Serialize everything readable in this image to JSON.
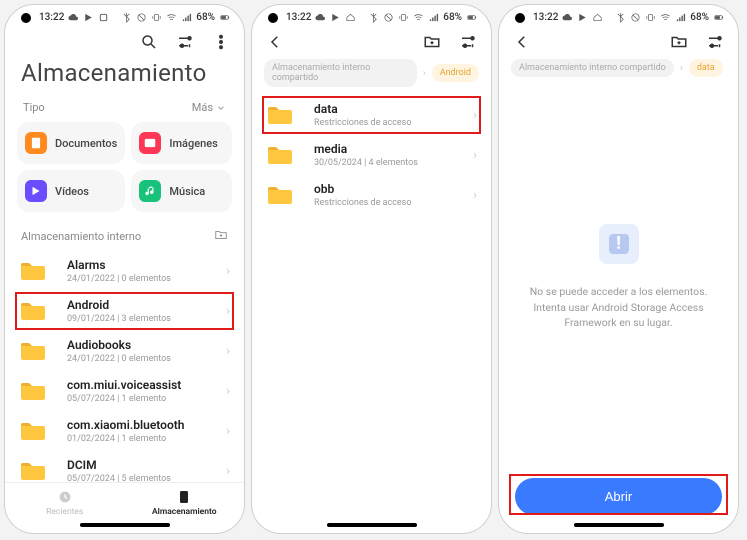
{
  "status": {
    "time": "13:22",
    "battery": "68%"
  },
  "s1": {
    "title": "Almacenamiento",
    "tipo": "Tipo",
    "mas": "Más",
    "cats": [
      {
        "label": "Documentos",
        "color": "#ff8a1f",
        "icon": "doc"
      },
      {
        "label": "Imágenes",
        "color": "#ff3757",
        "icon": "img"
      },
      {
        "label": "Vídeos",
        "color": "#6b4cff",
        "icon": "vid"
      },
      {
        "label": "Música",
        "color": "#19c27b",
        "icon": "mus"
      }
    ],
    "section": "Almacenamiento interno",
    "folders": [
      {
        "name": "Alarms",
        "sub": "24/01/2022 | 0 elementos"
      },
      {
        "name": "Android",
        "sub": "09/01/2024 | 3 elementos",
        "hl": true
      },
      {
        "name": "Audiobooks",
        "sub": "24/01/2022 | 0 elementos"
      },
      {
        "name": "com.miui.voiceassist",
        "sub": "05/07/2024 | 1 elemento"
      },
      {
        "name": "com.xiaomi.bluetooth",
        "sub": "01/02/2024 | 1 elemento"
      },
      {
        "name": "DCIM",
        "sub": "05/07/2024 | 5 elementos"
      }
    ],
    "nav": {
      "recent": "Recientes",
      "storage": "Almacenamiento"
    }
  },
  "s2": {
    "crumbs": [
      {
        "label": "Almacenamiento interno compartido",
        "active": false
      },
      {
        "label": "Android",
        "active": true
      }
    ],
    "folders": [
      {
        "name": "data",
        "sub": "Restricciones de acceso",
        "hl": true
      },
      {
        "name": "media",
        "sub": "30/05/2024 | 4 elementos"
      },
      {
        "name": "obb",
        "sub": "Restricciones de acceso"
      }
    ]
  },
  "s3": {
    "crumbs": [
      {
        "label": "Almacenamiento interno compartido",
        "active": false
      },
      {
        "label": "data",
        "active": true
      }
    ],
    "empty": "No se puede acceder a los elementos. Intenta usar Android Storage Access Framework en su lugar.",
    "cta": "Abrir"
  }
}
